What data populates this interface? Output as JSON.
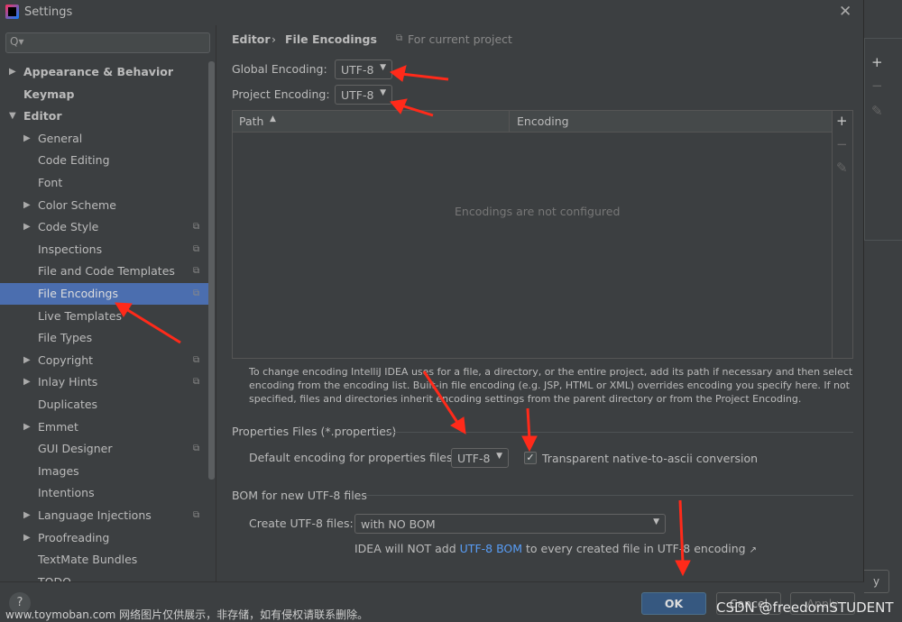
{
  "window": {
    "title": "Settings"
  },
  "search": {
    "placeholder": "Q▾"
  },
  "sidebar": {
    "items": [
      {
        "label": "Appearance & Behavior",
        "level": 0,
        "expandable": true,
        "expanded": false,
        "bold": true
      },
      {
        "label": "Keymap",
        "level": 0,
        "bold": true
      },
      {
        "label": "Editor",
        "level": 0,
        "expandable": true,
        "expanded": true,
        "bold": true
      },
      {
        "label": "General",
        "level": 1,
        "expandable": true
      },
      {
        "label": "Code Editing",
        "level": 1
      },
      {
        "label": "Font",
        "level": 1
      },
      {
        "label": "Color Scheme",
        "level": 1,
        "expandable": true
      },
      {
        "label": "Code Style",
        "level": 1,
        "expandable": true,
        "project": true
      },
      {
        "label": "Inspections",
        "level": 1,
        "project": true
      },
      {
        "label": "File and Code Templates",
        "level": 1,
        "project": true
      },
      {
        "label": "File Encodings",
        "level": 1,
        "project": true,
        "selected": true
      },
      {
        "label": "Live Templates",
        "level": 1
      },
      {
        "label": "File Types",
        "level": 1
      },
      {
        "label": "Copyright",
        "level": 1,
        "expandable": true,
        "project": true
      },
      {
        "label": "Inlay Hints",
        "level": 1,
        "expandable": true,
        "project": true
      },
      {
        "label": "Duplicates",
        "level": 1
      },
      {
        "label": "Emmet",
        "level": 1,
        "expandable": true
      },
      {
        "label": "GUI Designer",
        "level": 1,
        "project": true
      },
      {
        "label": "Images",
        "level": 1
      },
      {
        "label": "Intentions",
        "level": 1
      },
      {
        "label": "Language Injections",
        "level": 1,
        "expandable": true,
        "project": true
      },
      {
        "label": "Proofreading",
        "level": 1,
        "expandable": true
      },
      {
        "label": "TextMate Bundles",
        "level": 1
      },
      {
        "label": "TODO",
        "level": 1
      }
    ]
  },
  "breadcrumb": {
    "parent": "Editor",
    "separator": "›",
    "current": "File Encodings",
    "scope": "For current project"
  },
  "global_encoding": {
    "label": "Global Encoding:",
    "value": "UTF-8"
  },
  "project_encoding": {
    "label": "Project Encoding:",
    "value": "UTF-8"
  },
  "table": {
    "columns": [
      "Path",
      "Encoding"
    ],
    "sort_indicator": "▲",
    "empty_text": "Encodings are not configured",
    "tools": {
      "add": "+",
      "remove": "−",
      "edit": "✎"
    }
  },
  "help_text": [
    "To change encoding IntelliJ IDEA uses for a file, a directory, or the entire project, add its path if necessary and then select",
    "encoding from the encoding list. Built-in file encoding (e.g. JSP, HTML or XML) overrides encoding you specify here. If not",
    "specified, files and directories inherit encoding settings from the parent directory or from the Project Encoding."
  ],
  "properties": {
    "section": "Properties Files (*.properties)",
    "label": "Default encoding for properties files:",
    "value": "UTF-8",
    "checkbox_label": "Transparent native-to-ascii conversion",
    "checked": true
  },
  "bom": {
    "section": "BOM for new UTF-8 files",
    "label": "Create UTF-8 files:",
    "value": "with NO BOM",
    "note_prefix": "IDEA will NOT add ",
    "note_link": "UTF-8 BOM",
    "note_suffix": " to every created file in UTF-8 encoding",
    "note_icon": "↗"
  },
  "footer": {
    "help": "?",
    "ok": "OK",
    "cancel": "Cancel",
    "apply": "Apply",
    "behind_apply": "y"
  },
  "watermarks": {
    "left": "www.toymoban.com 网络图片仅供展示，非存储，如有侵权请联系删除。",
    "right": "CSDN @freedomSTUDENT"
  },
  "colors": {
    "accent": "#4b6eaf",
    "ok_button": "#365880",
    "link": "#589df6",
    "annotation_arrow": "#ff2a1a"
  }
}
